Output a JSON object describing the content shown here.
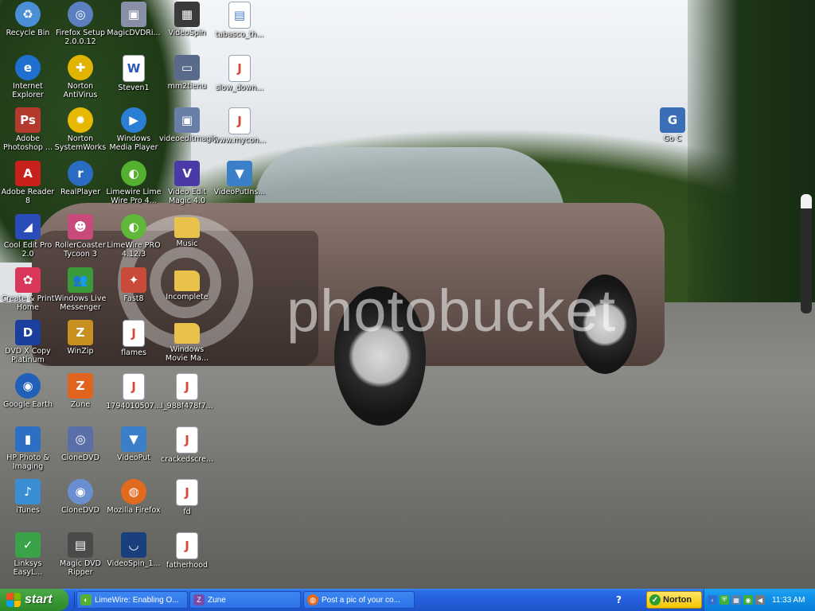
{
  "desktop_icons": [
    {
      "id": "recycle-bin",
      "label": "Recycle Bin",
      "icon": "recycle-bin-icon",
      "col": 0,
      "row": 0,
      "color": "#4a8fd6",
      "glyph": "♻"
    },
    {
      "id": "internet-explorer",
      "label": "Internet Explorer",
      "icon": "internet-explorer-icon",
      "col": 0,
      "row": 1,
      "color": "#1f6fd1",
      "glyph": "e"
    },
    {
      "id": "adobe-photoshop",
      "label": "Adobe Photoshop ...",
      "icon": "photoshop-icon",
      "col": 0,
      "row": 2,
      "color": "#b53a2e",
      "glyph": "Ps"
    },
    {
      "id": "adobe-reader",
      "label": "Adobe Reader 8",
      "icon": "adobe-reader-icon",
      "col": 0,
      "row": 3,
      "color": "#c8211b",
      "glyph": "A"
    },
    {
      "id": "cool-edit-pro",
      "label": "Cool Edit Pro 2.0",
      "icon": "cool-edit-icon",
      "col": 0,
      "row": 4,
      "color": "#2a4cb8",
      "glyph": "◢"
    },
    {
      "id": "create-print-home",
      "label": "Create & Print Home",
      "icon": "create-print-icon",
      "col": 0,
      "row": 5,
      "color": "#d9385a",
      "glyph": "✿"
    },
    {
      "id": "dvd-x-copy",
      "label": "DVD X Copy Platinum",
      "icon": "dvd-x-copy-icon",
      "col": 0,
      "row": 6,
      "color": "#1a3f9e",
      "glyph": "D"
    },
    {
      "id": "google-earth",
      "label": "Google Earth",
      "icon": "google-earth-icon",
      "col": 0,
      "row": 7,
      "color": "#2060b8",
      "glyph": "◉"
    },
    {
      "id": "hp-photo-imaging",
      "label": "HP Photo & Imaging",
      "icon": "hp-photo-icon",
      "col": 0,
      "row": 8,
      "color": "#2d6fc4",
      "glyph": "▮"
    },
    {
      "id": "itunes",
      "label": "iTunes",
      "icon": "itunes-icon",
      "col": 0,
      "row": 9,
      "color": "#3a8fd4",
      "glyph": "♪"
    },
    {
      "id": "linksys-easylink",
      "label": "Linksys EasyL...",
      "icon": "linksys-icon",
      "col": 0,
      "row": 10,
      "color": "#3aa34a",
      "glyph": "✓"
    },
    {
      "id": "firefox-setup",
      "label": "Firefox Setup 2.0.0.12",
      "icon": "installer-cd-icon",
      "col": 1,
      "row": 0,
      "color": "#5b7fbf",
      "glyph": "◎"
    },
    {
      "id": "norton-antivirus",
      "label": "Norton AntiVirus",
      "icon": "norton-antivirus-icon",
      "col": 1,
      "row": 1,
      "color": "#e0b400",
      "glyph": "✚"
    },
    {
      "id": "norton-systemworks",
      "label": "Norton SystemWorks",
      "icon": "norton-systemworks-icon",
      "col": 1,
      "row": 2,
      "color": "#e6b800",
      "glyph": "✹"
    },
    {
      "id": "realplayer",
      "label": "RealPlayer",
      "icon": "realplayer-icon",
      "col": 1,
      "row": 3,
      "color": "#2a6cc1",
      "glyph": "r"
    },
    {
      "id": "rollercoaster-tycoon",
      "label": "RollerCoaster Tycoon 3",
      "icon": "rollercoaster-icon",
      "col": 1,
      "row": 4,
      "color": "#c84a7a",
      "glyph": "☻"
    },
    {
      "id": "windows-live-messenger",
      "label": "Windows Live Messenger",
      "icon": "messenger-icon",
      "col": 1,
      "row": 5,
      "color": "#3a9a3a",
      "glyph": "👥"
    },
    {
      "id": "winzip",
      "label": "WinZip",
      "icon": "winzip-icon",
      "col": 1,
      "row": 6,
      "color": "#c89020",
      "glyph": "Z"
    },
    {
      "id": "zune",
      "label": "Zune",
      "icon": "zune-icon",
      "col": 1,
      "row": 7,
      "color": "#e0641e",
      "glyph": "Z"
    },
    {
      "id": "clonedvd-1",
      "label": "CloneDVD",
      "icon": "clonedvd-icon",
      "col": 1,
      "row": 8,
      "color": "#5a6fa8",
      "glyph": "◎"
    },
    {
      "id": "clonedvd-2",
      "label": "CloneDVD",
      "icon": "clonedvd-disc-icon",
      "col": 1,
      "row": 9,
      "color": "#6a8fd0",
      "glyph": "◉"
    },
    {
      "id": "magic-dvd-ripper",
      "label": "Magic DVD Ripper",
      "icon": "magic-dvd-ripper-icon",
      "col": 1,
      "row": 10,
      "color": "#4a4a4a",
      "glyph": "▤"
    },
    {
      "id": "magicdvdripper",
      "label": "MagicDVDRi...",
      "icon": "magicdvd-installer-icon",
      "col": 2,
      "row": 0,
      "color": "#8a8fa8",
      "glyph": "▣"
    },
    {
      "id": "steven1",
      "label": "Steven1",
      "icon": "word-document-icon",
      "col": 2,
      "row": 1,
      "color": "#2a55b8",
      "glyph": "W"
    },
    {
      "id": "windows-media-player",
      "label": "Windows Media Player",
      "icon": "media-player-icon",
      "col": 2,
      "row": 2,
      "color": "#2a7fd4",
      "glyph": "▶"
    },
    {
      "id": "limewire-lime",
      "label": "Limewire Lime Wire Pro 4...",
      "icon": "limewire-icon",
      "col": 2,
      "row": 3,
      "color": "#55b030",
      "glyph": "◐"
    },
    {
      "id": "limewire-pro",
      "label": "LimeWire PRO 4.12.3",
      "icon": "limewire-pro-icon",
      "col": 2,
      "row": 4,
      "color": "#60b83a",
      "glyph": "◐"
    },
    {
      "id": "fast8",
      "label": "Fast8",
      "icon": "fast8-icon",
      "col": 2,
      "row": 5,
      "color": "#c84a3a",
      "glyph": "✦"
    },
    {
      "id": "flames",
      "label": "flames",
      "icon": "jpeg-file-icon",
      "col": 2,
      "row": 6,
      "color": "#d04a3a",
      "glyph": "J"
    },
    {
      "id": "file-1794",
      "label": "1794010507...",
      "icon": "jpeg-file-icon",
      "col": 2,
      "row": 7,
      "color": "#d04a3a",
      "glyph": "J"
    },
    {
      "id": "videoput",
      "label": "VideoPut",
      "icon": "videoput-icon",
      "col": 2,
      "row": 8,
      "color": "#3a7fc8",
      "glyph": "▼"
    },
    {
      "id": "mozilla-firefox",
      "label": "Mozilla Firefox",
      "icon": "firefox-icon",
      "col": 2,
      "row": 9,
      "color": "#e06a1e",
      "glyph": "◍"
    },
    {
      "id": "videospin-1",
      "label": "VideoSpin_1...",
      "icon": "videospin-icon",
      "col": 2,
      "row": 10,
      "color": "#1a3f7e",
      "glyph": "◡"
    },
    {
      "id": "videospin",
      "label": "VideoSpin",
      "icon": "video-clapper-icon",
      "col": 3,
      "row": 0,
      "color": "#3a3a3a",
      "glyph": "▦"
    },
    {
      "id": "mm2tienu",
      "label": "mm2tienu",
      "icon": "application-window-icon",
      "col": 3,
      "row": 1,
      "color": "#5a6a8a",
      "glyph": "▭"
    },
    {
      "id": "videoeditmagic",
      "label": "videoeditmagic",
      "icon": "installer-icon",
      "col": 3,
      "row": 2,
      "color": "#6a7fa8",
      "glyph": "▣"
    },
    {
      "id": "video-edit-magic",
      "label": "Video Edit Magic 4.0",
      "icon": "video-edit-magic-icon",
      "col": 3,
      "row": 3,
      "color": "#4a3aa8",
      "glyph": "V"
    },
    {
      "id": "music",
      "label": "Music",
      "icon": "folder-icon",
      "col": 3,
      "row": 4,
      "color": "#e8c24a",
      "glyph": ""
    },
    {
      "id": "incomplete",
      "label": "Incomplete",
      "icon": "folder-icon",
      "col": 3,
      "row": 5,
      "color": "#e8c24a",
      "glyph": ""
    },
    {
      "id": "windows-movie-maker",
      "label": "Windows Movie Ma...",
      "icon": "folder-icon",
      "col": 3,
      "row": 6,
      "color": "#e8c24a",
      "glyph": ""
    },
    {
      "id": "file-988f478f7",
      "label": "l_988f478f7...",
      "icon": "jpeg-file-icon",
      "col": 3,
      "row": 7,
      "color": "#d04a3a",
      "glyph": "J"
    },
    {
      "id": "crackedscre",
      "label": "crackedscre...",
      "icon": "jpeg-file-icon",
      "col": 3,
      "row": 8,
      "color": "#d04a3a",
      "glyph": "J"
    },
    {
      "id": "fd",
      "label": "fd",
      "icon": "jpeg-file-icon",
      "col": 3,
      "row": 9,
      "color": "#d04a3a",
      "glyph": "J"
    },
    {
      "id": "fatherhood",
      "label": "fatherhood",
      "icon": "jpeg-file-icon",
      "col": 3,
      "row": 10,
      "color": "#d04a3a",
      "glyph": "J"
    },
    {
      "id": "tabasco",
      "label": "tabasco_th...",
      "icon": "image-file-icon",
      "col": 4,
      "row": 0,
      "color": "#4a7fc8",
      "glyph": "▤"
    },
    {
      "id": "slow-down",
      "label": "slow_down...",
      "icon": "jpeg-file-icon",
      "col": 4,
      "row": 1,
      "color": "#d04a3a",
      "glyph": "J"
    },
    {
      "id": "www-mycon",
      "label": "www.mycon...",
      "icon": "jpeg-file-icon",
      "col": 4,
      "row": 2,
      "color": "#d04a3a",
      "glyph": "J"
    },
    {
      "id": "videoputins",
      "label": "VideoPutIns...",
      "icon": "videoput-installer-icon",
      "col": 4,
      "row": 3,
      "color": "#3a7fc8",
      "glyph": "▼"
    },
    {
      "id": "go-c",
      "label": "Go C",
      "icon": "go-c-icon",
      "col": "goc",
      "row": 2,
      "color": "#3a6fb8",
      "glyph": "G"
    }
  ],
  "watermark": "photobucket",
  "taskbar": {
    "start_label": "start",
    "tasks": [
      {
        "label": "LimeWire: Enabling O...",
        "icon": "limewire-task-icon",
        "color": "#55b030"
      },
      {
        "label": "Zune",
        "icon": "zune-task-icon",
        "color": "#e0641e"
      },
      {
        "label": "Post a pic of your co...",
        "icon": "firefox-task-icon",
        "color": "#e06a1e"
      }
    ],
    "help_label": "?",
    "norton_label": "Norton",
    "clock": "11:33 AM"
  },
  "colors": {
    "taskbar": "#245edb",
    "start": "#3a9a36",
    "tray": "#0d8ee7"
  }
}
